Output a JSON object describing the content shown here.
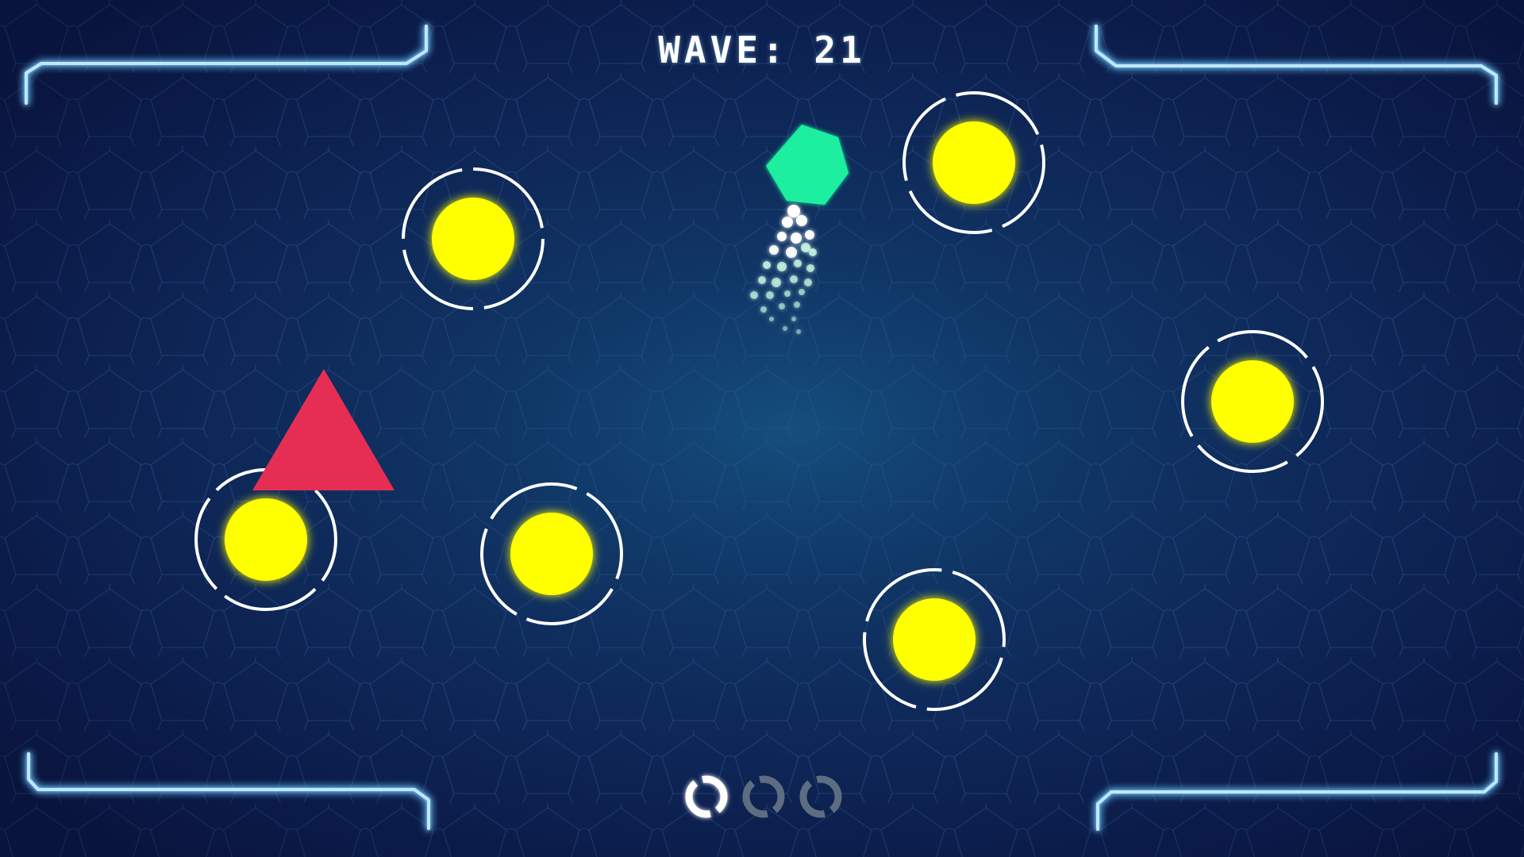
{
  "hud": {
    "wave_label": "WAVE: 21"
  },
  "player": {
    "shape": "hexagon",
    "color": "#1ef0a0"
  },
  "enemy": {
    "shape": "triangle",
    "color": "#e62e55"
  },
  "targets": {
    "count": 6,
    "color": "#ffff00",
    "ring_color": "#ffffff"
  },
  "lives": {
    "total": 3,
    "remaining": 1,
    "active_color": "#ffffff",
    "inactive_color": "#5f6d82"
  },
  "theme": {
    "frame_color": "#bfe8ff",
    "frame_glow": "#3fb4ff",
    "grid_line_color": "#2b4f86"
  }
}
